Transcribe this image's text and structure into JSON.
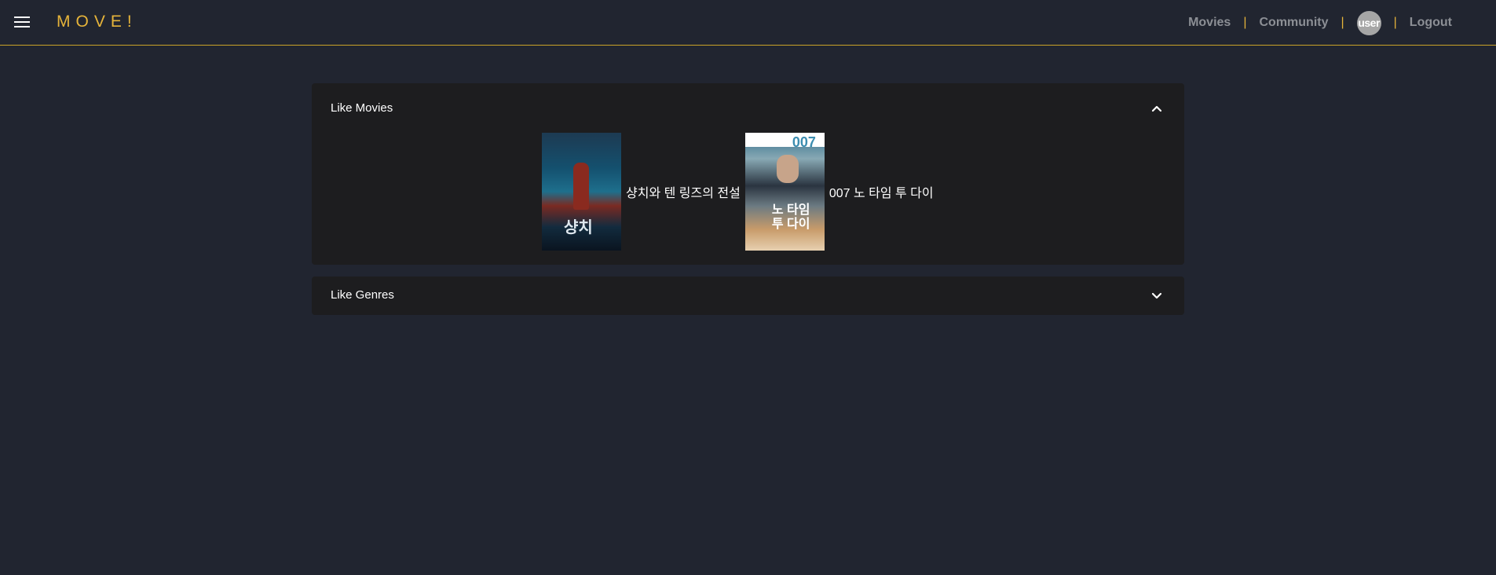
{
  "brand": "MOVE!",
  "nav": {
    "movies": "Movies",
    "separator": "|",
    "community": "Community",
    "avatar": "user",
    "logout": "Logout"
  },
  "sections": {
    "like_movies": {
      "title": "Like Movies",
      "expanded": true,
      "movies": [
        {
          "title": "샹치와 텐 링즈의 전설",
          "poster_text": "샹치"
        },
        {
          "title": "007 노 타임 투 다이",
          "poster_text": "노 타임 투 다이",
          "poster_number": "007"
        }
      ]
    },
    "like_genres": {
      "title": "Like Genres",
      "expanded": false
    }
  },
  "icons": {
    "menu": "hamburger-menu-icon",
    "collapse": "chevron-up-icon",
    "expand": "chevron-down-icon"
  },
  "colors": {
    "background": "#212530",
    "panel": "#1d1d1f",
    "accent": "#e6b43a",
    "nav_text": "#8c8f95",
    "avatar": "#a6a6a6"
  }
}
